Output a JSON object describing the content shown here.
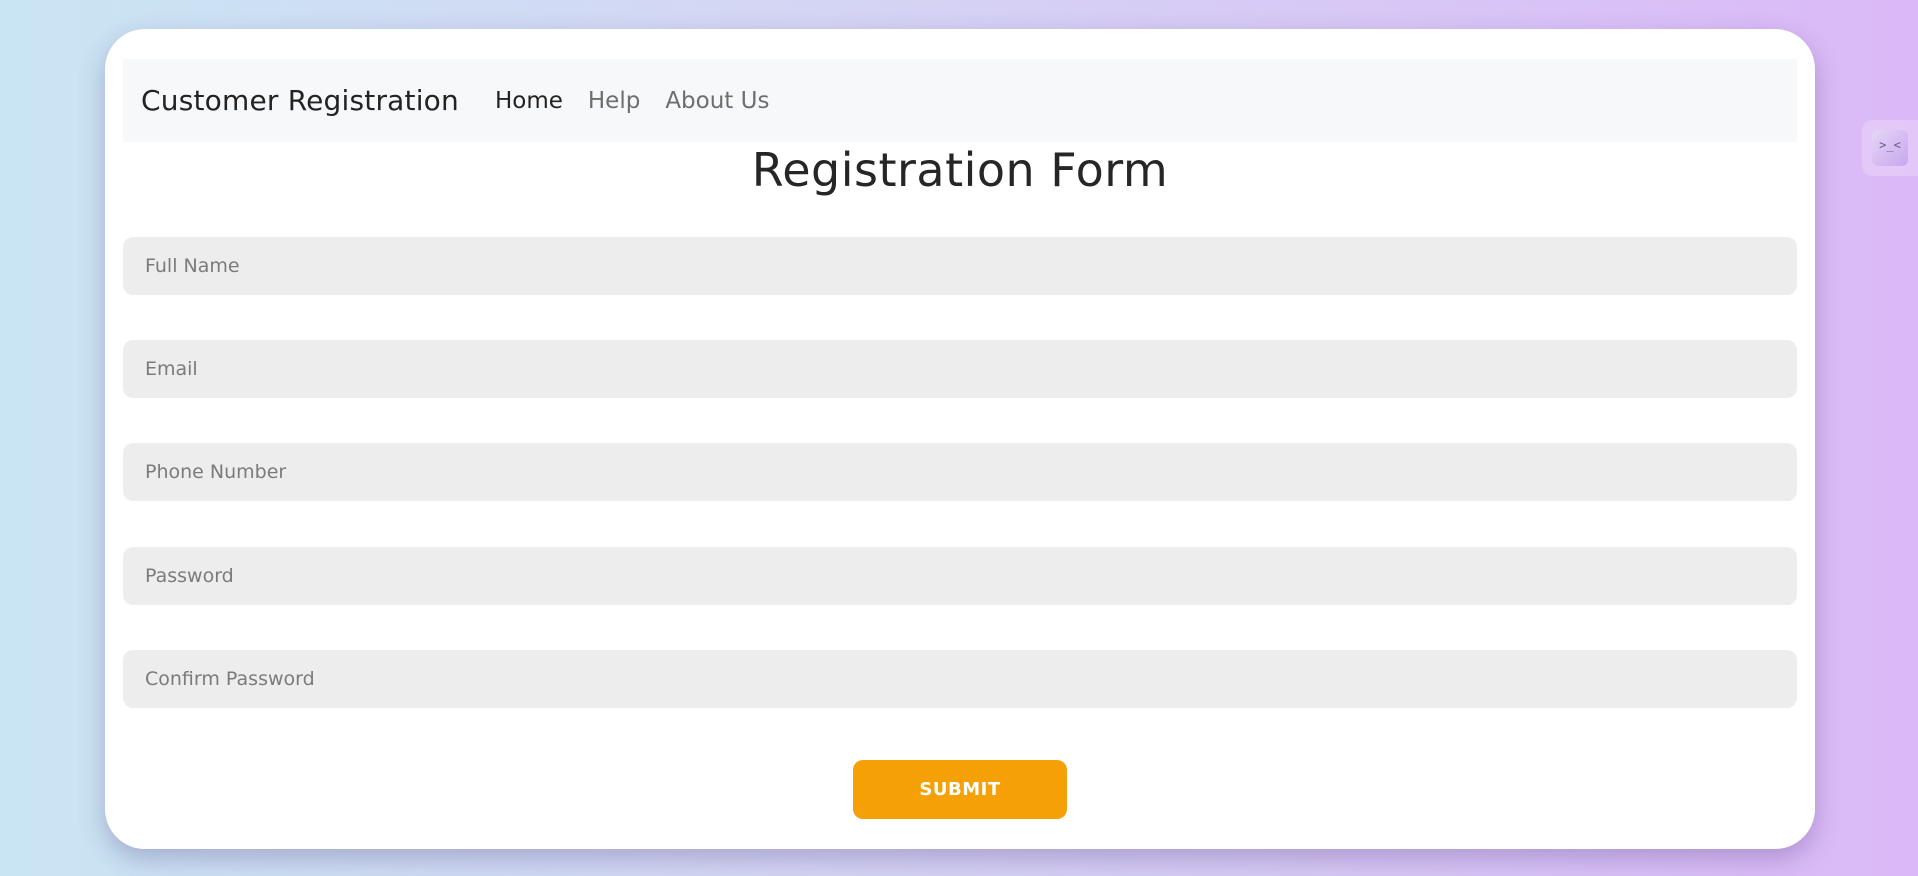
{
  "navbar": {
    "brand": "Customer Registration",
    "links": [
      {
        "label": "Home",
        "active": true
      },
      {
        "label": "Help",
        "active": false
      },
      {
        "label": "About Us",
        "active": false
      }
    ]
  },
  "form": {
    "title": "Registration Form",
    "fields": [
      {
        "placeholder": "Full Name",
        "value": ""
      },
      {
        "placeholder": "Email",
        "value": ""
      },
      {
        "placeholder": "Phone Number",
        "value": ""
      },
      {
        "placeholder": "Password",
        "value": ""
      },
      {
        "placeholder": "Confirm Password",
        "value": ""
      }
    ],
    "submit_label": "SUBMIT"
  },
  "side_widget": {
    "icon": "collapse-arrows-icon",
    "glyph": ">_<"
  },
  "colors": {
    "accent": "#f5a007",
    "card_background": "#ffffff",
    "input_background": "#ededed",
    "navbar_background": "#f7f8f9"
  }
}
